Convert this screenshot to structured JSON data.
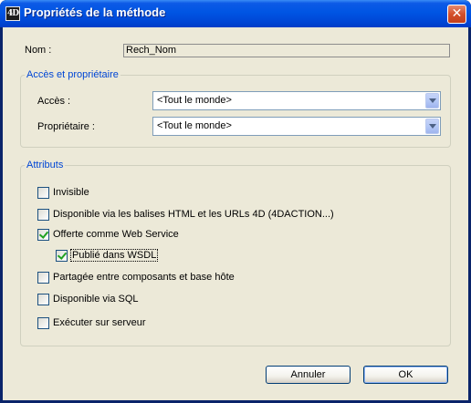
{
  "window": {
    "title": "Propriétés de la méthode",
    "icon_label": "4D",
    "close_glyph": "✕"
  },
  "name_row": {
    "label": "Nom :",
    "value": "Rech_Nom"
  },
  "access_group": {
    "legend": "Accès et propriétaire",
    "access_label": "Accès :",
    "access_value": "<Tout le monde>",
    "owner_label": "Propriétaire :",
    "owner_value": "<Tout le monde>"
  },
  "attributes_group": {
    "legend": "Attributs",
    "items": [
      {
        "label": "Invisible",
        "checked": false
      },
      {
        "label": "Disponible via les balises HTML et les URLs 4D (4DACTION...)",
        "checked": false
      },
      {
        "label": "Offerte comme Web Service",
        "checked": true
      },
      {
        "label": "Publié dans WSDL",
        "checked": true
      },
      {
        "label": "Partagée entre composants et base hôte",
        "checked": false
      },
      {
        "label": "Disponible via SQL",
        "checked": false
      },
      {
        "label": "Exécuter sur serveur",
        "checked": false
      }
    ]
  },
  "buttons": {
    "cancel_label": "Annuler",
    "ok_label": "OK"
  },
  "colors": {
    "titlebar": "#0055e3",
    "dialog_background": "#ece9d8",
    "group_legend": "#0046d5",
    "check_mark": "#21a121"
  }
}
